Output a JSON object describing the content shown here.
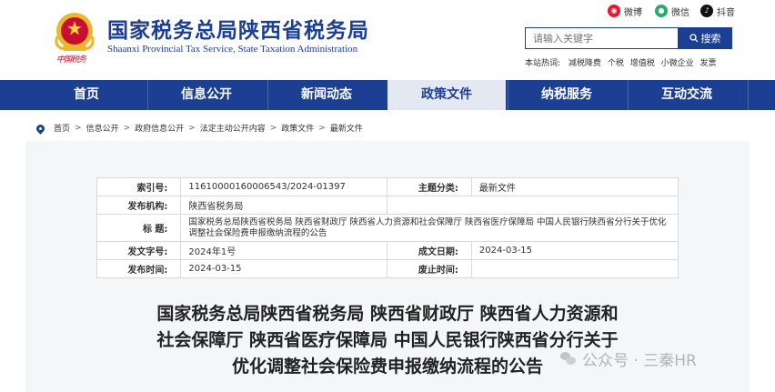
{
  "header": {
    "title": "国家税务总局陕西省税务局",
    "subtitle": "Shaanxi Provincial Tax Service, State Taxation Administration",
    "signature": "中国税务"
  },
  "social": {
    "weibo": "微博",
    "weixin": "微信",
    "douyin": "抖音"
  },
  "search": {
    "placeholder": "请输入关键字",
    "button": "搜索",
    "hot_label": "本站热词:",
    "hot_words": [
      "减税降费",
      "个税",
      "增值税",
      "小微企业",
      "发票"
    ]
  },
  "nav": {
    "items": [
      {
        "label": "首页"
      },
      {
        "label": "信息公开"
      },
      {
        "label": "新闻动态"
      },
      {
        "label": "政策文件"
      },
      {
        "label": "纳税服务"
      },
      {
        "label": "互动交流"
      }
    ],
    "active_index": 3
  },
  "breadcrumb": [
    "首页",
    "信息公开",
    "政府信息公开",
    "法定主动公开内容",
    "政策文件",
    "最新文件"
  ],
  "meta": {
    "index_label": "索引号:",
    "index_value": "11610000160006543/2024-01397",
    "category_label": "主题分类:",
    "category_value": "最新文件",
    "issuer_label": "发布机构:",
    "issuer_value": "陕西省税务局",
    "title_label": "标  题:",
    "title_value": "国家税务总局陕西省税务局 陕西省财政厅 陕西省人力资源和社会保障厅 陕西省医疗保障局 中国人民银行陕西省分行关于优化调整社会保险费申报缴纳流程的公告",
    "docno_label": "发文字号:",
    "docno_value": "2024年1号",
    "effective_label": "成文日期:",
    "effective_value": "2024-03-15",
    "pubdate_label": "发布时间:",
    "pubdate_value": "2024-03-15",
    "expire_label": "废止时间:",
    "expire_value": ""
  },
  "document": {
    "title_line1": "国家税务总局陕西省税务局 陕西省财政厅 陕西省人力资源和",
    "title_line2": "社会保障厅 陕西省医疗保障局 中国人民银行陕西省分行关于",
    "title_line3": "优化调整社会保险费申报缴纳流程的公告"
  },
  "watermark": "公众号 · 三秦HR",
  "colors": {
    "brand_blue": "#1c3f94",
    "emblem_red": "#c8102e",
    "emblem_gold": "#e9b82c",
    "weibo_red": "#e6162d",
    "weixin_green": "#2aae67",
    "douyin_black": "#111111"
  }
}
